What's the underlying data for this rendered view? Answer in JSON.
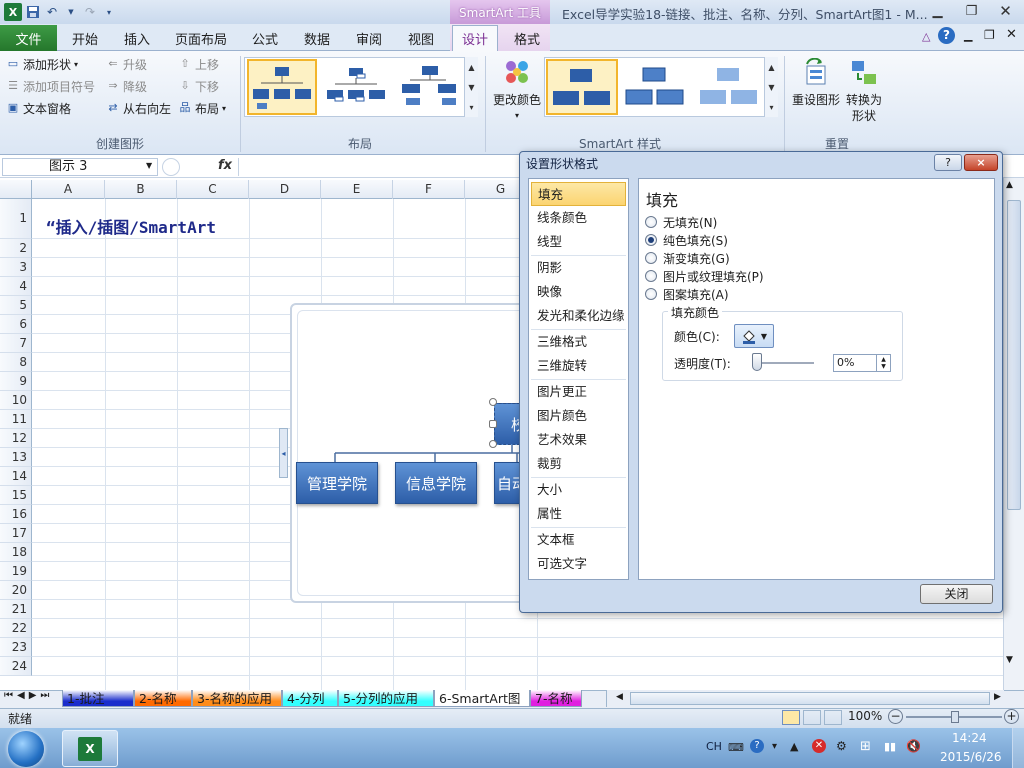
{
  "window": {
    "title": "Excel导学实验18-链接、批注、名称、分列、SmartArt图1 - M...",
    "contextual_group": "SmartArt 工具",
    "accent_green": "#2a8a33",
    "accent_purple": "#7b2e93"
  },
  "ribbon": {
    "tabs": [
      "文件",
      "开始",
      "插入",
      "页面布局",
      "公式",
      "数据",
      "审阅",
      "视图",
      "设计",
      "格式"
    ],
    "active_tab": "设计",
    "create_group": {
      "label": "创建图形",
      "add_shape": "添加形状",
      "add_bullet": "添加项目符号",
      "text_pane": "文本窗格",
      "promote": "升级",
      "demote": "降级",
      "right_to_left": "从右向左",
      "move_up": "上移",
      "move_down": "下移",
      "layout": "布局"
    },
    "layout_group": {
      "label": "布局"
    },
    "styles_group": {
      "label": "SmartArt 样式",
      "change_colors": "更改颜色"
    },
    "reset_group": {
      "label": "重置",
      "reset_graphic": "重设图形",
      "convert_line1": "转换为",
      "convert_line2": "形状"
    }
  },
  "formula_bar": {
    "name_box": "图示 3",
    "fx": "fx",
    "formula": ""
  },
  "sheet": {
    "columns": [
      "A",
      "B",
      "C",
      "D",
      "E",
      "F",
      "G"
    ],
    "rows": [
      "1",
      "2",
      "3",
      "4",
      "5",
      "6",
      "7",
      "8",
      "9",
      "10",
      "11",
      "12",
      "13",
      "14",
      "15",
      "16",
      "17",
      "18",
      "19",
      "20",
      "21",
      "22",
      "23",
      "24"
    ],
    "cell_a1": "“插入/插图/SmartArt",
    "smartart": {
      "top_node": "校",
      "child_nodes": [
        "管理学院",
        "信息学院",
        "自动"
      ]
    }
  },
  "sheet_tabs": [
    {
      "label": "1-批注",
      "color": "#1a2dcc"
    },
    {
      "label": "2-名称",
      "color": "#ff6a00"
    },
    {
      "label": "3-名称的应用",
      "color": "#ff8c1a"
    },
    {
      "label": "4-分列",
      "color": "#33ffff"
    },
    {
      "label": "5-分列的应用",
      "color": "#33ffff"
    },
    {
      "label": "6-SmartArt图",
      "color": "#ffffff"
    },
    {
      "label": "7-名称",
      "color": "#e020e0"
    }
  ],
  "status": {
    "ready": "就绪",
    "zoom": "100%"
  },
  "dialog": {
    "title": "设置形状格式",
    "help": "?",
    "close_x": "×",
    "nav": [
      [
        "填充",
        "线条颜色",
        "线型"
      ],
      [
        "阴影",
        "映像",
        "发光和柔化边缘"
      ],
      [
        "三维格式",
        "三维旋转"
      ],
      [
        "图片更正",
        "图片颜色",
        "艺术效果",
        "裁剪"
      ],
      [
        "大小",
        "属性"
      ],
      [
        "文本框",
        "可选文字"
      ]
    ],
    "selected_nav": "填充",
    "heading": "填充",
    "options": [
      "无填充(N)",
      "纯色填充(S)",
      "渐变填充(G)",
      "图片或纹理填充(P)",
      "图案填充(A)"
    ],
    "selected_option": "纯色填充(S)",
    "fill_color_group": "填充颜色",
    "color_label": "颜色(C):",
    "transparency_label": "透明度(T):",
    "transparency_value": "0%",
    "transparency_fraction": 0,
    "close_button": "关闭"
  },
  "taskbar": {
    "ime": "CH",
    "time": "14:24",
    "date": "2015/6/26"
  }
}
